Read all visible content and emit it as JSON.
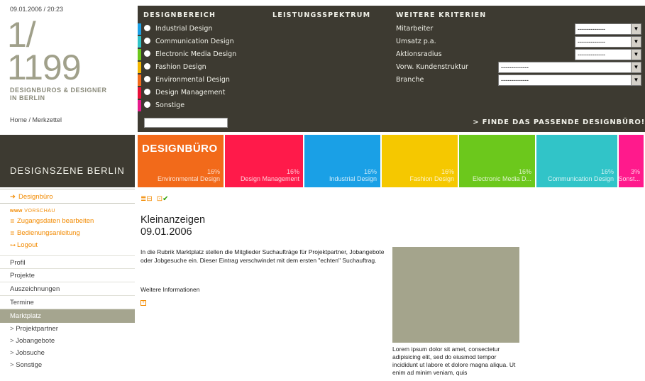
{
  "header": {
    "datetime": "09.01.2006 / 20:23",
    "count_line1": "1/",
    "count_line2": "1199",
    "subtitle_line1": "DESIGNBUROS & DESIGNER",
    "subtitle_line2": "IN BERLIN",
    "breadcrumb_home": "Home",
    "breadcrumb_sep": " / ",
    "breadcrumb_current": "Merkzettel"
  },
  "scene_title": "DESIGNSZENE BERLIN",
  "filter": {
    "heading_designbereich": "DESIGNBEREICH",
    "heading_leistungsspektrum": "LEISTUNGSSPEKTRUM",
    "heading_weitere": "WEITERE KRITERIEN",
    "areas": [
      {
        "label": "Industrial Design",
        "color": "#1aa0e6"
      },
      {
        "label": "Communication Design",
        "color": "#31c4c8"
      },
      {
        "label": "Electronic Media Design",
        "color": "#6cc81c"
      },
      {
        "label": "Fashion Design",
        "color": "#f5b800"
      },
      {
        "label": "Environmental Design",
        "color": "#f26a1a"
      },
      {
        "label": "Design Management",
        "color": "#e8103a"
      },
      {
        "label": "Sonstige",
        "color": "#e61a8c"
      }
    ],
    "criteria": [
      {
        "label": "Mitarbeiter",
        "value": "-------------"
      },
      {
        "label": "Umsatz p.a.",
        "value": "-------------"
      },
      {
        "label": "Aktionsradius",
        "value": "-------------"
      },
      {
        "label": "Vorw. Kundenstruktur",
        "value": "-------------"
      },
      {
        "label": "Branche",
        "value": "-------------"
      }
    ],
    "find_label": "> FINDE DAS PASSENDE DESIGNBÜRO!"
  },
  "tiles_title": "DESIGNBÜRO",
  "tiles": [
    {
      "pct": "16%",
      "label": "Environmental Design",
      "color": "#f26a1a"
    },
    {
      "pct": "16%",
      "label": "Design Management",
      "color": "#ff1a4a"
    },
    {
      "pct": "16%",
      "label": "Industrial Design",
      "color": "#1aa0e6"
    },
    {
      "pct": "16%",
      "label": "Fashion Design",
      "color": "#f5c800"
    },
    {
      "pct": "16%",
      "label": "Electronic Media D...",
      "color": "#6cc81c"
    },
    {
      "pct": "16%",
      "label": "Communication Design",
      "color": "#31c4c8"
    },
    {
      "pct": "3%",
      "label": "Sonst...",
      "color": "#ff1a8c"
    }
  ],
  "sidenav": {
    "active": "Designbüro",
    "preview_prefix": "www",
    "preview_label": "VORSCHAU",
    "sub_links": [
      "Zugangsdaten bearbeiten",
      "Bedienungsanleitung",
      "Logout"
    ],
    "items": [
      "Profil",
      "Projekte",
      "Auszeichnungen",
      "Termine"
    ],
    "current": "Marktplatz",
    "children": [
      "Projektpartner",
      "Jobangebote",
      "Jobsuche",
      "Sonstige"
    ]
  },
  "content": {
    "title_line1": "Kleinanzeigen",
    "title_line2": "09.01.2006",
    "intro": "In die Rubrik Marktplatz stellen die Mitglieder Suchaufträge für Projektpartner, Jobangebote oder Jobgesuche ein. Dieser Eintrag verschwindet mit dem ersten \"echten\" Suchauftrag.",
    "more_label": "Weitere Informationen",
    "lorem": "Lorem ipsum dolor sit amet, consectetur adipisicing elit, sed do eiusmod tempor incididunt ut labore et dolore magna aliqua. Ut enim ad minim veniam, quis"
  }
}
